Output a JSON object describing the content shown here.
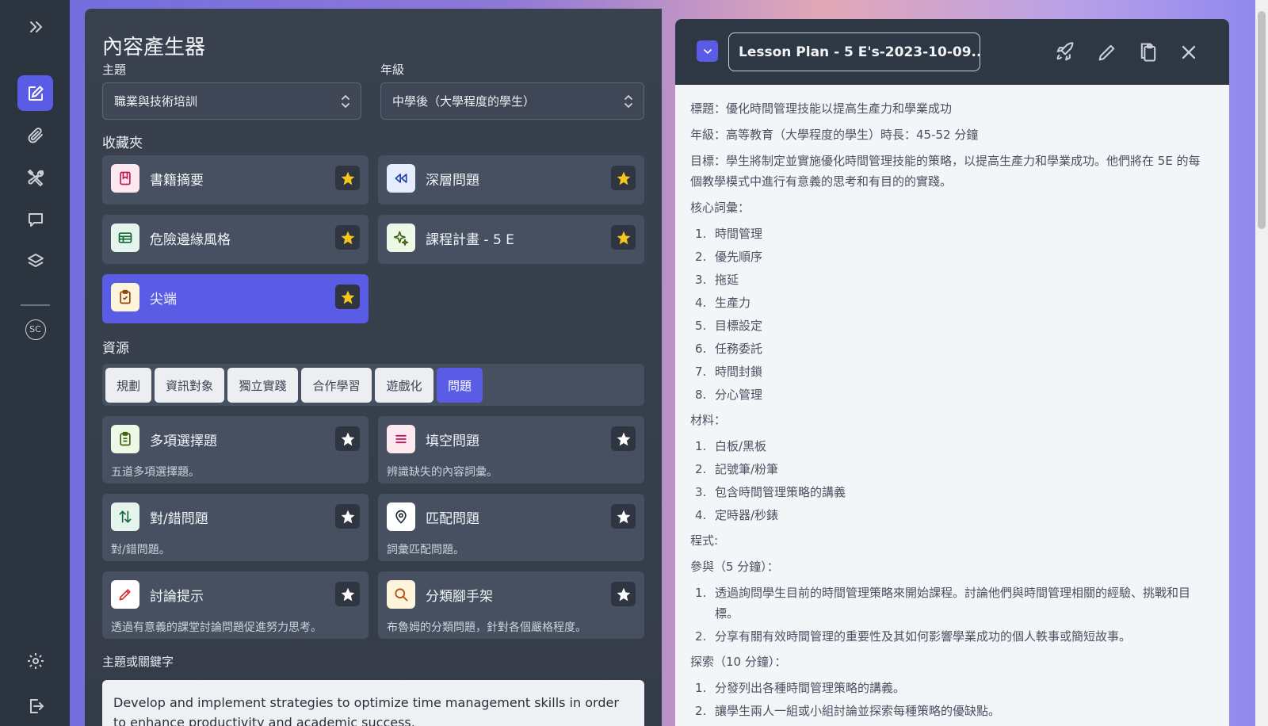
{
  "main": {
    "title": "內容產生器",
    "subject_label": "主題",
    "subject_value": "職業與技術培訓",
    "grade_label": "年級",
    "grade_value": "中學後（大學程度的學生）",
    "favorites_label": "收藏夾",
    "favorites": [
      {
        "label": "書籍摘要",
        "icon": "bookmark-icon"
      },
      {
        "label": "深層問題",
        "icon": "rewind-icon"
      },
      {
        "label": "危險邊緣風格",
        "icon": "table-icon"
      },
      {
        "label": "課程計畫 - 5 E",
        "icon": "sparkle-icon"
      },
      {
        "label": "尖端",
        "icon": "clipboard-icon"
      }
    ],
    "resources_label": "資源",
    "tabs": [
      "規劃",
      "資訊對象",
      "獨立實踐",
      "合作學習",
      "遊戲化",
      "問題"
    ],
    "resources": [
      {
        "label": "多項選擇題",
        "desc": "五道多項選擇題。",
        "icon": "clipboard-check-icon"
      },
      {
        "label": "填空問題",
        "desc": "辨識缺失的內容詞彙。",
        "icon": "lines-icon"
      },
      {
        "label": "對/錯問題",
        "desc": "對/錯問題。",
        "icon": "swap-arrows-icon"
      },
      {
        "label": "匹配問題",
        "desc": "詞彙匹配問題。",
        "icon": "target-icon"
      },
      {
        "label": "討論提示",
        "desc": "透過有意義的課堂討論問題促進努力思考。",
        "icon": "pencil-icon"
      },
      {
        "label": "分類腳手架",
        "desc": "布魯姆的分類問題，針對各個嚴格程度。",
        "icon": "magnifier-icon"
      }
    ],
    "topic_label": "主題或關鍵字",
    "topic_value": "Develop and implement strategies to optimize time management skills in order to enhance productivity and academic success."
  },
  "rail": {
    "avatar_initials": "SC"
  },
  "doc": {
    "title": "Lesson Plan - 5 E's-2023-10-09...",
    "line_title": "標題：優化時間管理技能以提高生產力和學業成功",
    "line_grade": "年級：高等教育（大學程度的學生）時長：45-52 分鐘",
    "line_objective": "目標：學生將制定並實施優化時間管理技能的策略，以提高生產力和學業成功。他們將在 5E 的每個教學模式中進行有意義的思考和有目的的實踐。",
    "vocab_label": "核心詞彙：",
    "vocab": [
      "時間管理",
      "優先順序",
      "拖延",
      "生產力",
      "目標設定",
      "任務委託",
      "時間封鎖",
      "分心管理"
    ],
    "materials_label": "材料：",
    "materials": [
      "白板/黑板",
      "記號筆/粉筆",
      "包含時間管理策略的講義",
      "定時器/秒錶"
    ],
    "procedure_label": "程式:",
    "engage_label": "參與（5 分鐘）：",
    "engage": [
      "透過詢問學生目前的時間管理策略來開始課程。討論他們與時間管理相關的經驗、挑戰和目標。",
      "分享有關有效時間管理的重要性及其如何影響學業成功的個人軼事或簡短故事。"
    ],
    "explore_label": "探索（10 分鐘）：",
    "explore": [
      "分發列出各種時間管理策略的講義。",
      "讓學生兩人一組或小組討論並探索每種策略的優缺點。"
    ]
  },
  "colors": {
    "accent": "#5b5ce6",
    "star": "#f5c518",
    "panel": "#39414f",
    "rail": "#2c3440"
  }
}
